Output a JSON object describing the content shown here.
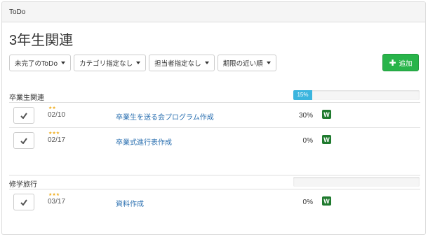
{
  "panel": {
    "heading": "ToDo"
  },
  "page": {
    "title": "3年生関連"
  },
  "filters": [
    {
      "label": "未完了のToDo"
    },
    {
      "label": "カテゴリ指定なし"
    },
    {
      "label": "担当者指定なし"
    },
    {
      "label": "期限の近い順"
    }
  ],
  "add_button": {
    "label": "追加"
  },
  "colors": {
    "accent": "#28b44a",
    "progress": "#3bb5de",
    "link": "#2a6fb0",
    "star": "#f0ad1e",
    "w_badge": "#1f7a2e"
  },
  "groups": [
    {
      "title": "卒業生関連",
      "progress": 0.15,
      "progress_label": "15%",
      "tasks": [
        {
          "stars": "★★",
          "date": "02/10",
          "title": "卒業生を送る会プログラム作成",
          "percent": "30%",
          "badge": "W"
        },
        {
          "stars": "★★★",
          "date": "02/17",
          "title": "卒業式進行表作成",
          "percent": "0%",
          "badge": "W"
        }
      ]
    },
    {
      "title": "修学旅行",
      "progress": 0,
      "progress_label": "",
      "tasks": [
        {
          "stars": "★★★",
          "date": "03/17",
          "title": "資料作成",
          "percent": "0%",
          "badge": "W"
        }
      ]
    }
  ]
}
